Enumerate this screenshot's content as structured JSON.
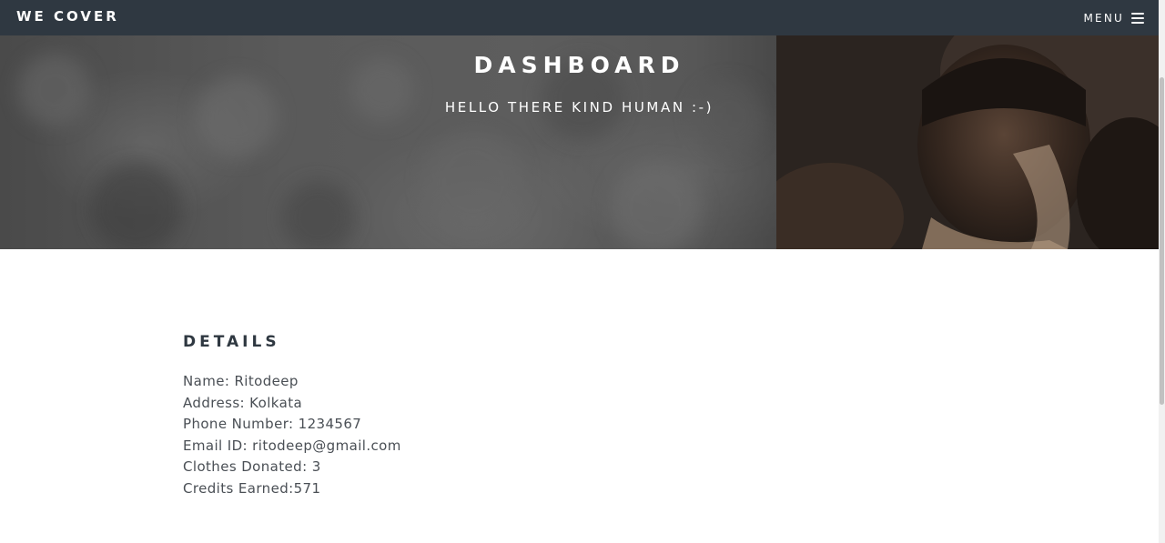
{
  "navbar": {
    "brand": "WE COVER",
    "menu_label": "MENU",
    "menu_icon": "hamburger-icon"
  },
  "hero": {
    "title": "DASHBOARD",
    "subtitle": "HELLO THERE KIND HUMAN :-)"
  },
  "details": {
    "heading": "DETAILS",
    "lines": [
      "Name: Ritodeep",
      "Address: Kolkata",
      "Phone Number: 1234567",
      "Email ID: ritodeep@gmail.com",
      "Clothes Donated: 3",
      "Credits Earned:571"
    ]
  },
  "colors": {
    "navbar_bg": "#2f3841",
    "heading": "#2f3841",
    "body_text": "#4a4f55",
    "white": "#ffffff"
  }
}
